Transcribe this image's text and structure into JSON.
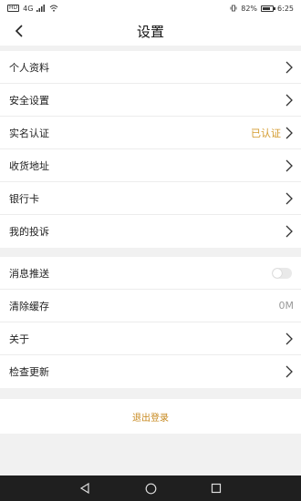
{
  "status_bar": {
    "left_text": "HD",
    "chip": "4G",
    "battery_percent": "82%",
    "battery_level": 0.82,
    "time": "6:25"
  },
  "title": "设置",
  "group1": [
    {
      "label": "个人资料",
      "value": ""
    },
    {
      "label": "安全设置",
      "value": ""
    },
    {
      "label": "实名认证",
      "value": "已认证"
    },
    {
      "label": "收货地址",
      "value": ""
    },
    {
      "label": "银行卡",
      "value": ""
    },
    {
      "label": "我的投诉",
      "value": ""
    }
  ],
  "group2": {
    "push_label": "消息推送",
    "push_enabled": false,
    "cache_label": "清除缓存",
    "cache_value": "0M",
    "about_label": "关于",
    "update_label": "检查更新"
  },
  "logout_label": "退出登录",
  "icons": {
    "back": "back-arrow-icon",
    "chevron": "chevron-right-icon",
    "nav_back": "triangle-back-icon",
    "nav_home": "circle-home-icon",
    "nav_recent": "square-recent-icon"
  },
  "colors": {
    "accent": "#d39a2c",
    "logout": "#c7891f",
    "background": "#f1f1f1",
    "nav_bar": "#1f1f1f"
  }
}
